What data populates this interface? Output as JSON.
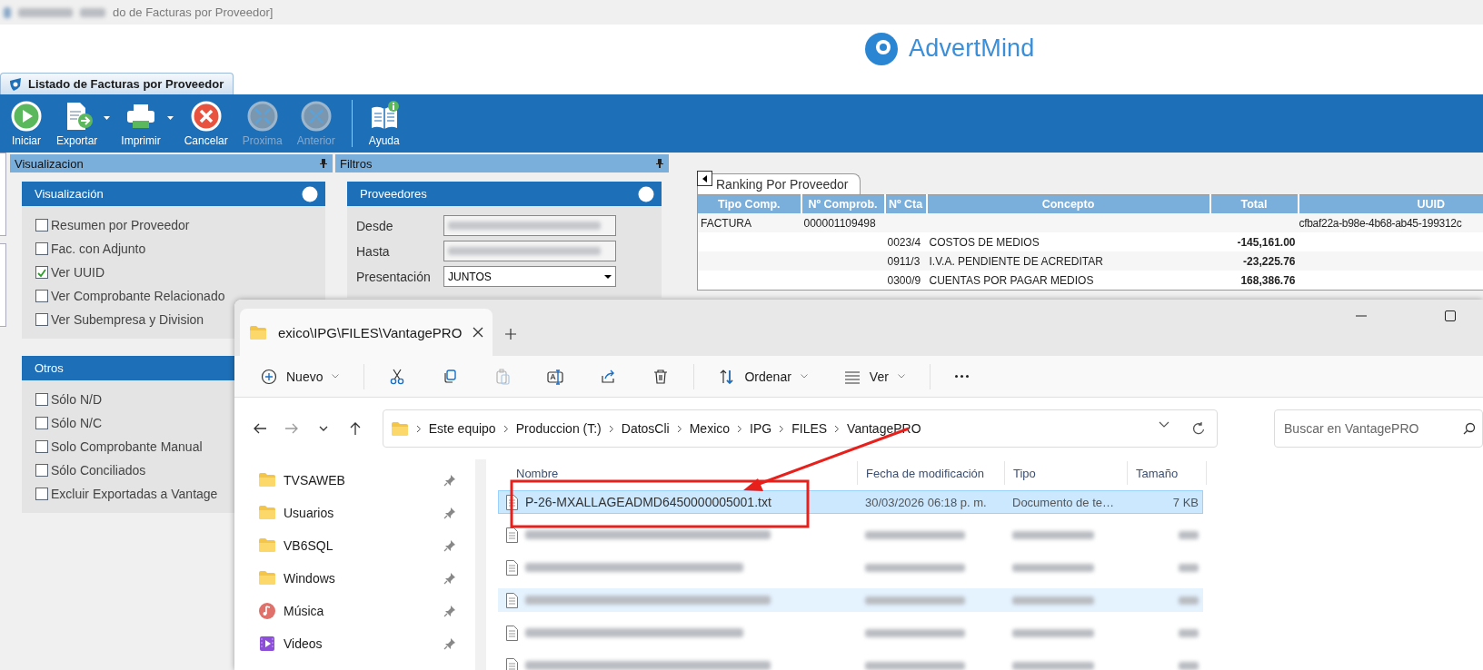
{
  "title_bar": {
    "title": "do de Facturas por Proveedor]"
  },
  "logo": {
    "text": "AdvertMind"
  },
  "document_tabs": [
    {
      "label": "Listado de Facturas por Proveedor",
      "selected": true
    }
  ],
  "toolbar": [
    {
      "label": "Iniciar",
      "kind": "play",
      "disabled": false,
      "dropdown": false
    },
    {
      "label": "Exportar",
      "kind": "export",
      "disabled": false,
      "dropdown": true
    },
    {
      "label": "Imprimir",
      "kind": "print",
      "disabled": false,
      "dropdown": true
    },
    {
      "label": "Cancelar",
      "kind": "cancel",
      "disabled": false,
      "dropdown": false
    },
    {
      "label": "Proxima",
      "kind": "expand",
      "disabled": true,
      "dropdown": false
    },
    {
      "label": "Anterior",
      "kind": "collapse",
      "disabled": true,
      "dropdown": false
    },
    {
      "label": "Ayuda",
      "kind": "help",
      "disabled": false,
      "dropdown": false
    }
  ],
  "panels": [
    {
      "title": "Visualizacion",
      "groups": [
        {
          "title": "Visualización",
          "toggle": true,
          "options": [
            {
              "label": "Resumen por Proveedor",
              "checked": false
            },
            {
              "label": "Fac. con Adjunto",
              "checked": false
            },
            {
              "label": "Ver UUID",
              "checked": true
            },
            {
              "label": "Ver Comprobante Relacionado",
              "checked": false
            },
            {
              "label": "Ver Subempresa y Division",
              "checked": false
            }
          ]
        },
        {
          "title": "Otros",
          "options": [
            {
              "label": "Sólo N/D",
              "checked": false
            },
            {
              "label": "Sólo N/C",
              "checked": false
            },
            {
              "label": "Solo Comprobante Manual",
              "checked": false
            },
            {
              "label": "Sólo Conciliados",
              "checked": false
            },
            {
              "label": "Excluir Exportadas a Vantage",
              "checked": false
            }
          ]
        }
      ]
    },
    {
      "title": "Filtros",
      "groups": [
        {
          "title": "Proveedores",
          "toggle": true,
          "fields": [
            {
              "label": "Desde",
              "kind": "redacted"
            },
            {
              "label": "Hasta",
              "kind": "redacted"
            },
            {
              "label": "Presentación",
              "kind": "combo",
              "value": "JUNTOS"
            }
          ]
        }
      ]
    }
  ],
  "report": {
    "tab": "Ranking Por Proveedor",
    "columns": [
      "Tipo Comp.",
      "Nº Comprob.",
      "Nº Cta",
      "Concepto",
      "Total",
      "UUID"
    ],
    "rows": [
      [
        "FACTURA",
        "000001109498",
        "",
        "",
        "",
        "cfbaf22a-b98e-4b68-ab45-199312c"
      ],
      [
        "",
        "",
        "0023/4",
        "COSTOS DE MEDIOS",
        "-145,161.00",
        ""
      ],
      [
        "",
        "",
        "0911/3",
        "I.V.A. PENDIENTE DE ACREDITAR",
        "-23,225.76",
        ""
      ],
      [
        "",
        "",
        "0300/9",
        "CUENTAS POR PAGAR MEDIOS",
        "168,386.76",
        ""
      ]
    ]
  },
  "explorer": {
    "tab": "exico\\IPG\\FILES\\VantagePRO",
    "commands": [
      {
        "kind": "new",
        "label": "Nuevo",
        "disabled": false
      },
      {
        "kind": "cut",
        "disabled": false
      },
      {
        "kind": "copy",
        "disabled": false
      },
      {
        "kind": "paste",
        "disabled": true
      },
      {
        "kind": "rename",
        "disabled": false
      },
      {
        "kind": "share",
        "disabled": false
      },
      {
        "kind": "delete",
        "disabled": false
      },
      {
        "kind": "sort",
        "label": "Ordenar",
        "disabled": false
      },
      {
        "kind": "view",
        "label": "Ver",
        "disabled": false
      },
      {
        "kind": "more",
        "disabled": false
      }
    ],
    "breadcrumbs": [
      "Este equipo",
      "Produccion (T:)",
      "DatosCli",
      "Mexico",
      "IPG",
      "FILES",
      "VantagePRO"
    ],
    "search": {
      "placeholder": "Buscar en VantagePRO"
    },
    "sidebar": [
      {
        "label": "TVSAWEB",
        "kind": "folder"
      },
      {
        "label": "Usuarios",
        "kind": "folder"
      },
      {
        "label": "VB6SQL",
        "kind": "folder"
      },
      {
        "label": "Windows",
        "kind": "folder"
      },
      {
        "label": "Música",
        "kind": "music"
      },
      {
        "label": "Videos",
        "kind": "video"
      }
    ],
    "columns": [
      "Nombre",
      "Fecha de modificación",
      "Tipo",
      "Tamaño"
    ],
    "files": [
      {
        "kind": "file",
        "name": "P-26-MXALLAGEADMD6450000005001.txt",
        "date": "30/03/2026 06:18 p. m.",
        "type": "Documento de te…",
        "size": "7 KB",
        "selected": true,
        "hover": false
      },
      {
        "kind": "redacted",
        "selected": false,
        "hover": false
      },
      {
        "kind": "redacted",
        "selected": false,
        "hover": false
      },
      {
        "kind": "redacted",
        "selected": false,
        "hover": true
      },
      {
        "kind": "redacted",
        "selected": false,
        "hover": false
      },
      {
        "kind": "redacted",
        "selected": false,
        "hover": false
      }
    ]
  }
}
